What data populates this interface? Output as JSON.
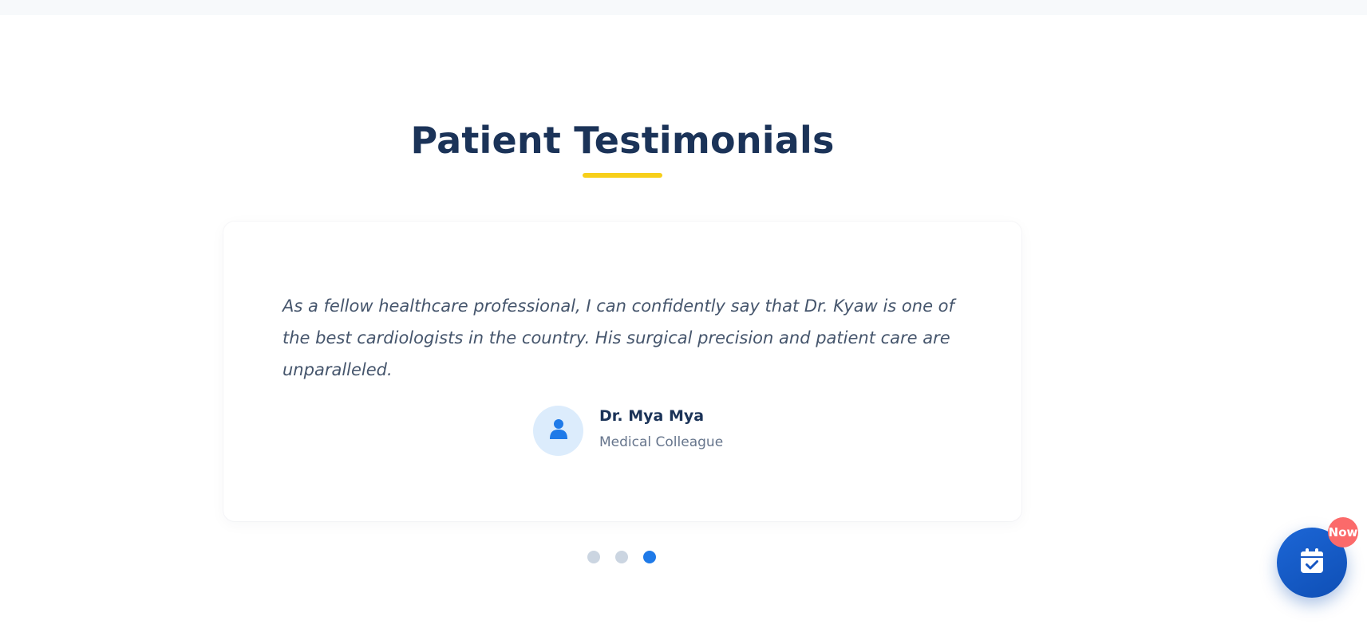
{
  "section": {
    "title": "Patient Testimonials"
  },
  "testimonial": {
    "quote": "As a fellow healthcare professional, I can confidently say that Dr. Kyaw is one of the best cardiologists in the country. His surgical precision and patient care are unparalleled.",
    "author_name": "Dr. Mya Mya",
    "author_role": "Medical Colleague",
    "avatar_icon": "user-icon"
  },
  "carousel": {
    "dot_count": 3,
    "active_index": 2
  },
  "appointment_button": {
    "icon": "calendar-check-icon",
    "badge": "Now"
  },
  "colors": {
    "heading": "#1b3358",
    "accent_underline": "#f7cf1a",
    "active_dot": "#1f7ae8",
    "inactive_dot": "#cbd5e1",
    "fab": "#1c66d6",
    "badge": "#fb6a6a"
  }
}
